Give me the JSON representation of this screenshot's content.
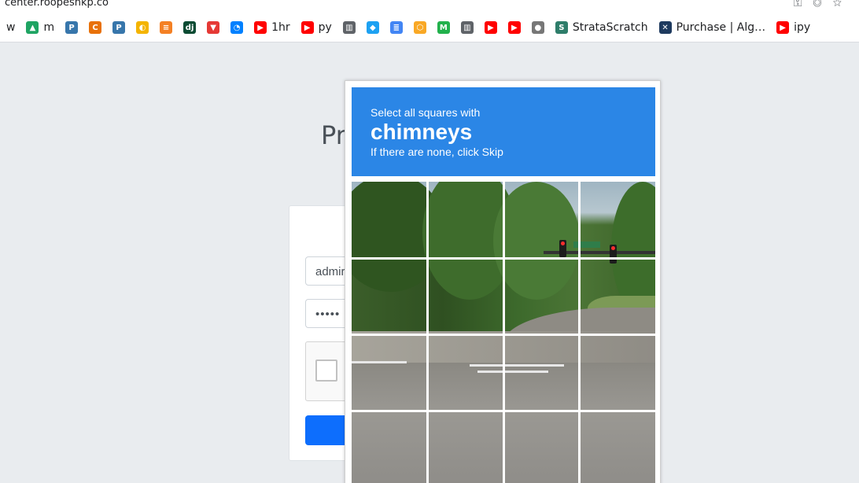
{
  "browser": {
    "url": "center.roopeshkp.co",
    "url_icons": [
      "key-icon",
      "eye-off-icon",
      "star-icon"
    ],
    "bookmarks": [
      {
        "label": "w",
        "icon": "none",
        "color": ""
      },
      {
        "label": "m",
        "icon": "google-drive-icon",
        "color": "#1fa463"
      },
      {
        "label": "",
        "icon": "python-icon",
        "color": "#3776ab"
      },
      {
        "label": "",
        "icon": "c-logo-icon",
        "color": "#e8710a"
      },
      {
        "label": "",
        "icon": "python-icon",
        "color": "#3776ab"
      },
      {
        "label": "",
        "icon": "color-wheel-icon",
        "color": "#f4b400"
      },
      {
        "label": "",
        "icon": "stack-overflow-icon",
        "color": "#f48024"
      },
      {
        "label": "",
        "icon": "django-icon",
        "color": "#0c4b33"
      },
      {
        "label": "",
        "icon": "vercel-triangle-icon",
        "color": "#e53935"
      },
      {
        "label": "",
        "icon": "digitalocean-icon",
        "color": "#0080ff"
      },
      {
        "label": "1hr",
        "icon": "youtube-icon",
        "color": "#ff0000"
      },
      {
        "label": "py",
        "icon": "youtube-icon",
        "color": "#ff0000"
      },
      {
        "label": "",
        "icon": "book-icon",
        "color": "#5f6368"
      },
      {
        "label": "",
        "icon": "graduation-cap-icon",
        "color": "#1da1f2"
      },
      {
        "label": "",
        "icon": "google-docs-icon",
        "color": "#4285f4"
      },
      {
        "label": "",
        "icon": "hexagon-icon",
        "color": "#f9a825"
      },
      {
        "label": "",
        "icon": "m-logo-icon",
        "color": "#22b14c"
      },
      {
        "label": "",
        "icon": "book-icon",
        "color": "#5f6368"
      },
      {
        "label": "",
        "icon": "youtube-icon",
        "color": "#ff0000"
      },
      {
        "label": "",
        "icon": "youtube-icon",
        "color": "#ff0000"
      },
      {
        "label": "",
        "icon": "circle-badge-icon",
        "color": "#777777"
      },
      {
        "label": "StrataScratch",
        "icon": "stratascratch-icon",
        "color": "#2e7d6a"
      },
      {
        "label": "Purchase | Alg…",
        "icon": "algoexpert-icon",
        "color": "#1e3a5f"
      },
      {
        "label": "ipy",
        "icon": "youtube-icon",
        "color": "#ff0000"
      }
    ]
  },
  "page": {
    "heading": "Pr",
    "username_value": "admir",
    "password_value": "•••••"
  },
  "captcha": {
    "line1": "Select all squares with",
    "target": "chimneys",
    "line3": "If there are none, click Skip",
    "header_color": "#2b86e6",
    "rows": 4,
    "cols": 4
  }
}
